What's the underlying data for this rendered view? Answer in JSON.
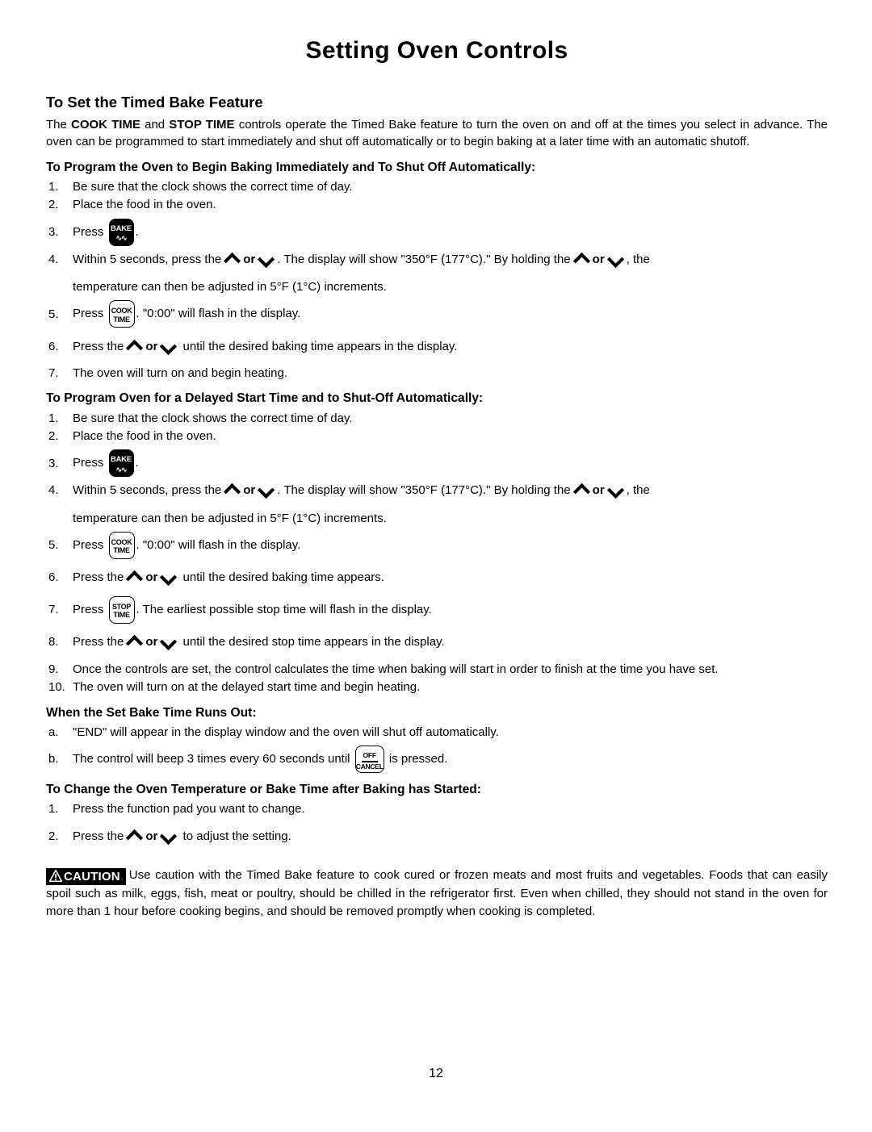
{
  "page": {
    "title": "Setting Oven Controls",
    "page_number": "12"
  },
  "section_main": {
    "heading": "To Set the Timed Bake Feature",
    "intro_pre": "The ",
    "intro_b1": "COOK TIME",
    "intro_mid": " and ",
    "intro_b2": "STOP TIME",
    "intro_post": " controls operate the Timed Bake feature to turn the oven on and off at the times you select in advance. The oven can be programmed to start immediately and shut off automatically or to begin baking at a later time with an automatic shutoff."
  },
  "immediate": {
    "heading": "To Program the Oven to Begin Baking Immediately and To Shut Off Automatically:",
    "step1_num": "1.",
    "step1_text": "Be sure that the clock shows the correct time of day.",
    "step2_num": "2.",
    "step2_text": "Place the food in the oven.",
    "step3_num": "3.",
    "step3_pre": "Press",
    "step3_post": ".",
    "step4_num": "4.",
    "step4_a": "Within 5 seconds, press the",
    "step4_or": "or",
    "step4_b": ". The display will show \"350°F (177°C).\" By holding the",
    "step4_or2": "or",
    "step4_c": ", the",
    "step4_line2": "temperature can then be adjusted in 5°F (1°C) increments.",
    "step5_num": "5.",
    "step5_pre": "Press",
    "step5_post": ". \"0:00\" will flash in the display.",
    "step6_num": "6.",
    "step6_a": "Press the",
    "step6_or": "or",
    "step6_b": "until the desired baking time appears in the display.",
    "step7_num": "7.",
    "step7_text": "The oven will turn on and begin heating."
  },
  "delayed": {
    "heading": "To Program Oven for a Delayed Start Time and to Shut-Off Automatically:",
    "step1_num": "1.",
    "step1_text": "Be sure that the clock shows the correct time of day.",
    "step2_num": "2.",
    "step2_text": "Place the food in the oven.",
    "step3_num": "3.",
    "step3_pre": "Press",
    "step3_post": ".",
    "step4_num": "4.",
    "step4_a": "Within 5 seconds, press the",
    "step4_or": "or",
    "step4_b": ". The display will show \"350°F (177°C).\" By holding the",
    "step4_or2": "or",
    "step4_c": ", the",
    "step4_line2": "temperature can then be adjusted in 5°F (1°C) increments.",
    "step5_num": "5.",
    "step5_pre": "Press",
    "step5_post": ". \"0:00\" will flash in the display.",
    "step6_num": "6.",
    "step6_a": "Press the",
    "step6_or": "or",
    "step6_b": "until the desired baking time appears.",
    "step7_num": "7.",
    "step7_pre": "Press",
    "step7_post": ". The earliest possible stop time will flash in the display.",
    "step8_num": "8.",
    "step8_a": "Press the",
    "step8_or": "or",
    "step8_b": "until the desired stop time appears in the display.",
    "step9_num": "9.",
    "step9_text": "Once the controls are set, the control calculates the time when baking will start in order to finish at the time you have set.",
    "step10_num": "10.",
    "step10_text": "The oven will turn on at the delayed start time and begin heating."
  },
  "runs_out": {
    "heading": "When the Set Bake Time Runs Out:",
    "item_a_num": "a.",
    "item_a_text": "\"END\" will appear in the display window and the oven will shut off automatically.",
    "item_b_num": "b.",
    "item_b_pre": "The control will beep 3 times every 60 seconds until",
    "item_b_post": "is pressed."
  },
  "change": {
    "heading": "To Change the Oven Temperature or Bake Time after Baking has Started:",
    "step1_num": "1.",
    "step1_text": "Press the function pad you want to change.",
    "step2_num": "2.",
    "step2_a": "Press the",
    "step2_or": "or",
    "step2_b": "to adjust the setting."
  },
  "caution": {
    "badge_label": "CAUTION",
    "text": "Use caution with the Timed Bake feature to cook cured or frozen meats and most fruits and vegetables. Foods that can easily spoil such as milk, eggs, fish, meat or poultry, should be chilled in the refrigerator first. Even when chilled, they should not stand in the oven for more than 1 hour before cooking begins, and should be removed promptly when cooking is completed."
  },
  "keys": {
    "bake_label": "BAKE",
    "bake_wave": "∿∿",
    "cook_line1": "COOK",
    "cook_line2": "TIME",
    "stop_line1": "STOP",
    "stop_line2": "TIME",
    "off_label": "OFF",
    "cancel_label": "CANCEL"
  },
  "colors": {
    "ink": "#000000",
    "paper": "#ffffff"
  }
}
